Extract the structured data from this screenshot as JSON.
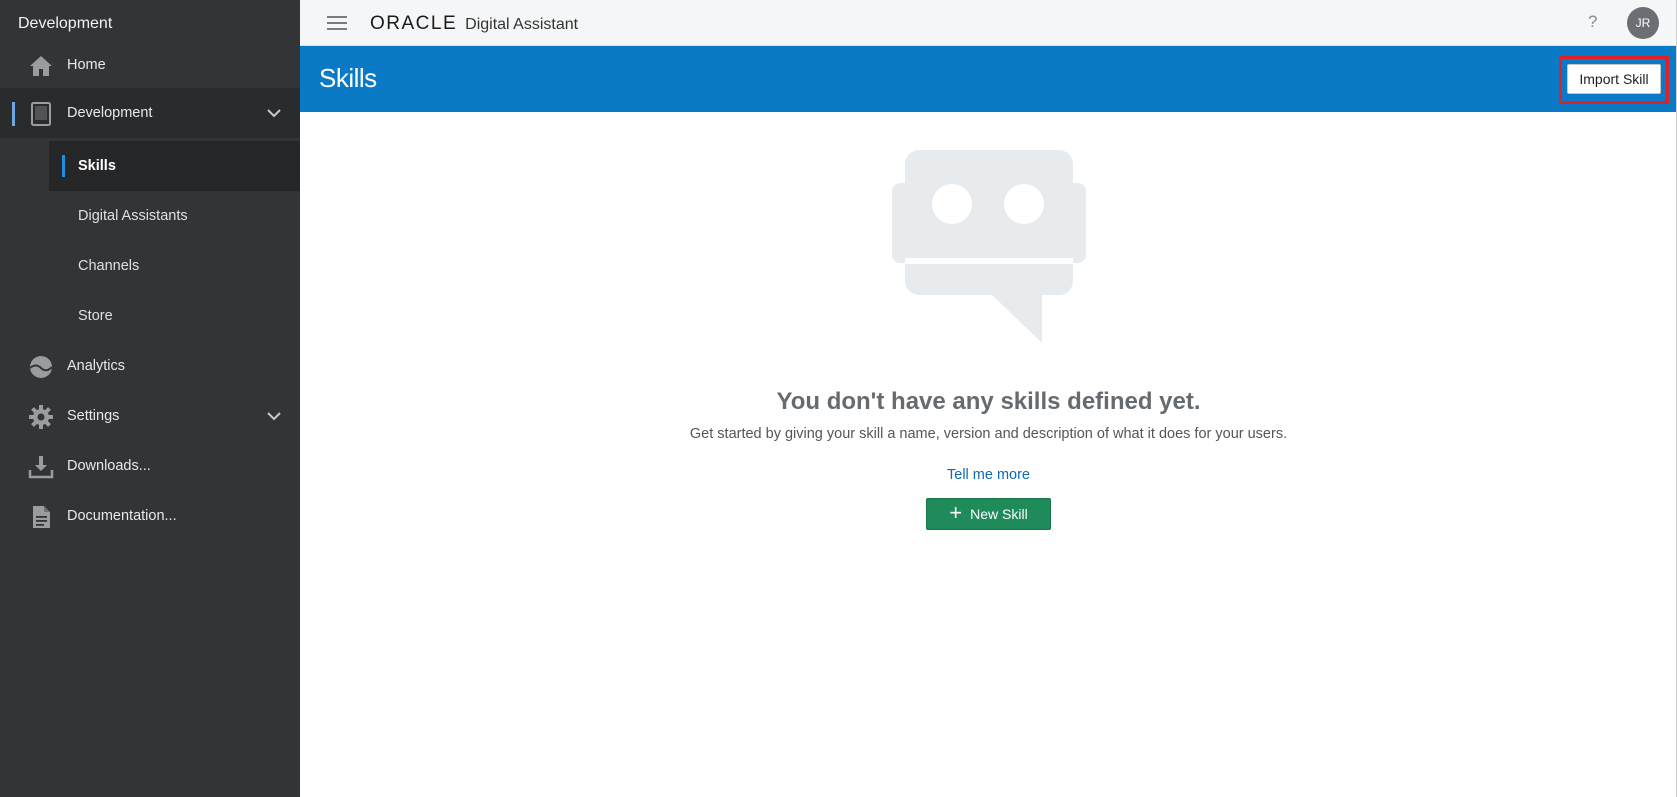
{
  "sidebar": {
    "title": "Development",
    "items": [
      {
        "label": "Home",
        "icon": "home-icon"
      },
      {
        "label": "Development",
        "icon": "tablet-icon"
      },
      {
        "label": "Analytics",
        "icon": "analytics-icon"
      },
      {
        "label": "Settings",
        "icon": "gear-icon"
      },
      {
        "label": "Downloads...",
        "icon": "download-icon"
      },
      {
        "label": "Documentation...",
        "icon": "document-icon"
      }
    ],
    "subitems": [
      {
        "label": "Skills"
      },
      {
        "label": "Digital Assistants"
      },
      {
        "label": "Channels"
      },
      {
        "label": "Store"
      }
    ]
  },
  "header": {
    "brand": "ORACLE",
    "product": "Digital Assistant",
    "help": "?",
    "avatar": "JR"
  },
  "titlebar": {
    "title": "Skills",
    "import_label": "Import Skill"
  },
  "empty": {
    "heading": "You don't have any skills defined yet.",
    "description": "Get started by giving your skill a name, version and description of what it does for your users.",
    "link": "Tell me more",
    "button_icon": "+",
    "button_label": "New Skill"
  },
  "colors": {
    "sidebar": "#323436",
    "titlebar": "#0a7ac6",
    "primary_button": "#1f8a5a",
    "highlight": "#e3202a"
  }
}
